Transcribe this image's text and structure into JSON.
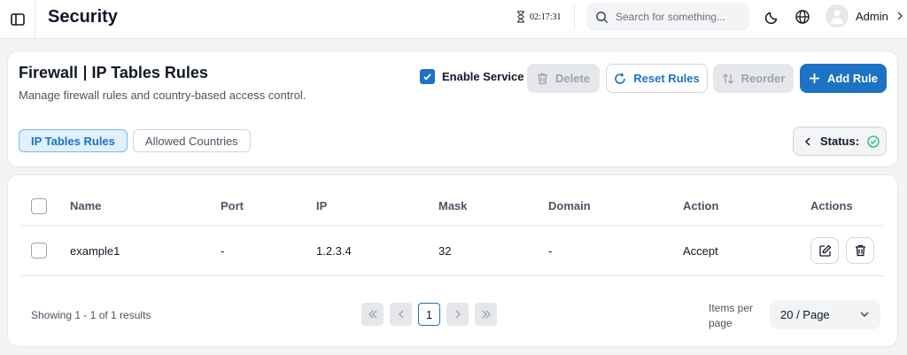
{
  "header": {
    "title": "Security",
    "clock": "02:17:31",
    "search_placeholder": "Search for something...",
    "user_name": "Admin"
  },
  "page": {
    "title_part1": "Firewall",
    "title_part2": "IP Tables Rules",
    "subtitle": "Manage firewall rules and country-based access control.",
    "enable_service_label": "Enable Service",
    "enable_service_checked": true,
    "buttons": {
      "delete": "Delete",
      "reset": "Reset Rules",
      "reorder": "Reorder",
      "add": "Add Rule"
    },
    "tabs": [
      {
        "label": "IP Tables Rules",
        "active": true
      },
      {
        "label": "Allowed Countries",
        "active": false
      }
    ],
    "status_label": "Status:"
  },
  "table": {
    "columns": [
      "Name",
      "Port",
      "IP",
      "Mask",
      "Domain",
      "Action",
      "Actions"
    ],
    "rows": [
      {
        "name": "example1",
        "port": "-",
        "ip": "1.2.3.4",
        "mask": "32",
        "domain": "-",
        "action": "Accept"
      }
    ]
  },
  "pagination": {
    "summary": "Showing 1 - 1 of 1 results",
    "current_page": "1",
    "items_per_page_label": "Items per page",
    "page_size": "20 / Page"
  },
  "colors": {
    "accent": "#1d72c4",
    "status_ok": "#10b981"
  }
}
